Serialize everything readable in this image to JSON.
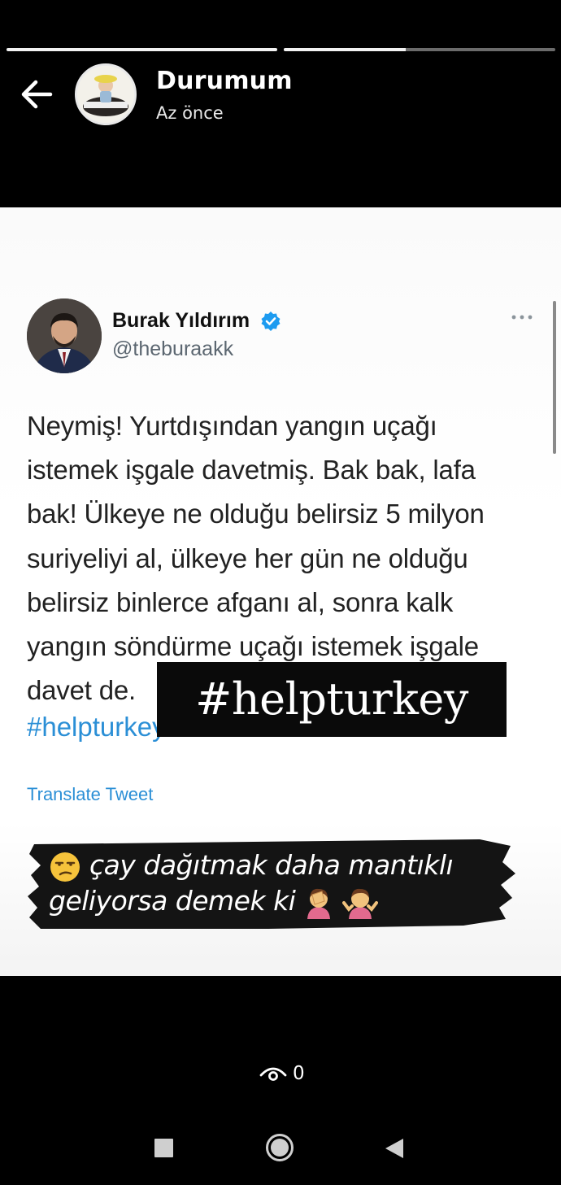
{
  "status": {
    "title": "Durumum",
    "time": "Az önce",
    "progress": [
      1.0,
      0.45
    ]
  },
  "tweet": {
    "author_name": "Burak Yıldırım",
    "author_handle": "@theburaakk",
    "lines": [
      "Neymiş! Yurtdışından yangın uçağı",
      "istemek işgale davetmiş. Bak bak, lafa",
      "bak! Ülkeye ne olduğu belirsiz 5 milyon",
      "suriyeliyi al, ülkeye her gün ne olduğu",
      "belirsiz binlerce afganı al, sonra kalk",
      "yangın söndürme uçağı istemek işgale",
      "davet de."
    ],
    "hashtag": "#helpturkey",
    "translate_label": "Translate Tweet"
  },
  "stickers": {
    "hashtag_sticker": "#helpturkey",
    "caption_line1": "çay dağıtmak daha mantıklı",
    "caption_line2": "geliyorsa demek ki"
  },
  "footer": {
    "view_count": "0"
  },
  "icons": {
    "back": "arrow-left-icon",
    "verified": "verified-badge-icon",
    "more": "more-dots-icon",
    "eye": "eye-icon",
    "unamused": "unamused-face-emoji",
    "facepalm": "facepalm-emoji",
    "shrug": "shrug-emoji"
  },
  "colors": {
    "link_blue": "#2b8fd6",
    "verified_blue": "#1d9bf0",
    "background": "#000000"
  }
}
